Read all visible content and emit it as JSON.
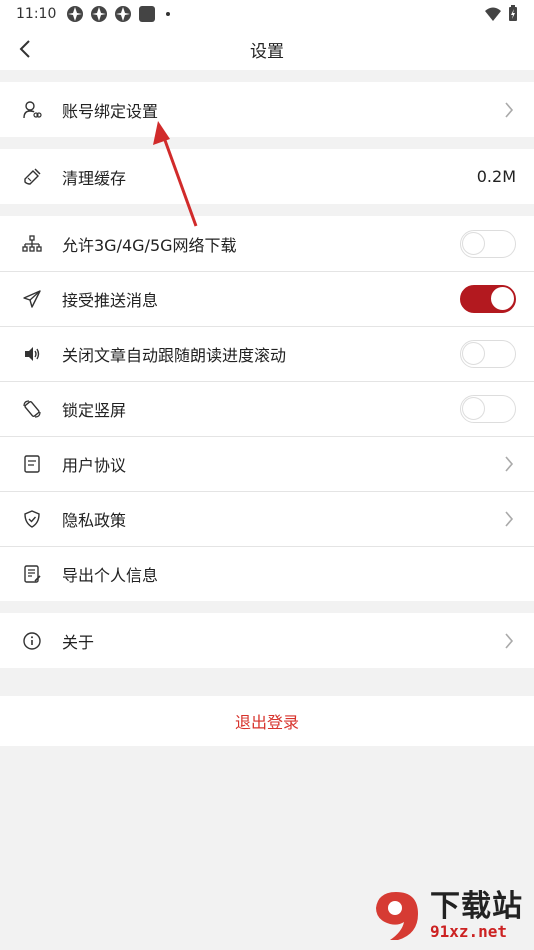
{
  "status_bar": {
    "time": "11:10"
  },
  "header": {
    "title": "设置"
  },
  "groups": {
    "account": {
      "label": "账号绑定设置"
    },
    "cache": {
      "label": "清理缓存",
      "value": "0.2M"
    },
    "download": {
      "label": "允许3G/4G/5G网络下载",
      "enabled": false
    },
    "push": {
      "label": "接受推送消息",
      "enabled": true
    },
    "read_scroll": {
      "label": "关闭文章自动跟随朗读进度滚动",
      "enabled": false
    },
    "lock_portrait": {
      "label": "锁定竖屏",
      "enabled": false
    },
    "user_agreement": {
      "label": "用户协议"
    },
    "privacy": {
      "label": "隐私政策"
    },
    "export_info": {
      "label": "导出个人信息"
    },
    "about": {
      "label": "关于"
    }
  },
  "logout": {
    "label": "退出登录"
  },
  "watermark": {
    "title": "下载站",
    "url": "91xz.net"
  },
  "colors": {
    "accent": "#b3191f",
    "logout_text": "#d7332c",
    "annotation_arrow": "#d12b2b"
  }
}
